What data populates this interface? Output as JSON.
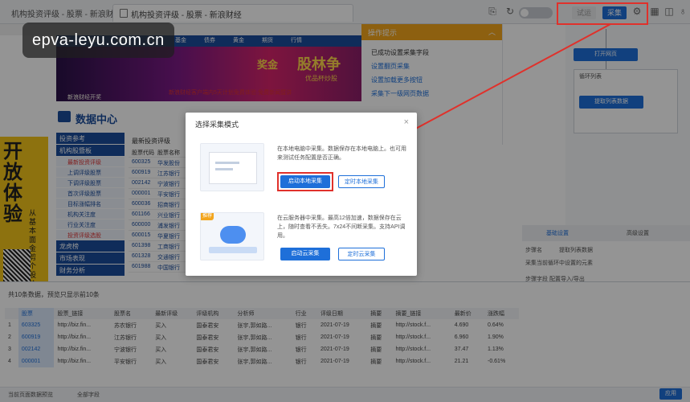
{
  "app": {
    "window_title": "机构投资评级 - 股票 - 新浪财经",
    "tab_title": "机构投资评级 - 股票 - 新浪财经"
  },
  "toolbar": {
    "trial_label": "试运",
    "collect_label": "采集"
  },
  "website": {
    "nav": [
      "首页",
      "新闻",
      "财经",
      "外汇",
      "基金",
      "债券",
      "黄金",
      "期货",
      "行情"
    ],
    "banner_texts": [
      "奖金",
      "股林争",
      "优品杯炒股",
      "新浪财经开奖"
    ],
    "notice": "新浪财经客户端内5天计划免费体验·免费新闻暨讲",
    "data_center_title": "数据中心",
    "left_ad_text": "开放体验",
    "left_ad_sub": "从基本面金剪个股价值",
    "side_menu": [
      {
        "group": "投资参考",
        "items": []
      },
      {
        "group": "机构股暨板",
        "items": [
          "最新投资评级",
          "上调评级股票",
          "下调评级股票",
          "首次评级股票",
          "目标涨幅排名",
          "机构关注度",
          "行业关注度",
          "投资评级选股"
        ]
      },
      {
        "group": "龙虎榜",
        "items": []
      },
      {
        "group": "市场表现",
        "items": []
      },
      {
        "group": "财务分析",
        "items": []
      }
    ],
    "table_title": "最新投资评级",
    "table_headers": [
      "股票代码",
      "股票名称"
    ],
    "table_rows": [
      [
        "600325",
        "华发股份"
      ],
      [
        "600919",
        "江苏银行"
      ],
      [
        "002142",
        "宁波银行"
      ],
      [
        "000001",
        "平安银行"
      ],
      [
        "600036",
        "招商银行"
      ],
      [
        "601166",
        "兴业银行"
      ],
      [
        "600000",
        "浦发银行"
      ],
      [
        "600015",
        "华夏银行"
      ],
      [
        "601398",
        "工商银行"
      ],
      [
        "601328",
        "交通银行"
      ],
      [
        "601988",
        "中国银行"
      ]
    ]
  },
  "right_panel": {
    "tips_title": "操作提示",
    "tips_items": [
      "已成功设置采集字段",
      "设置翻页采集",
      "设置加载更多按钮",
      "采集下一级网页数据"
    ],
    "flow_nodes": [
      "打开网页",
      "循环列表",
      "提取列表数据"
    ],
    "settings_tabs": [
      "基础设置",
      "高级设置"
    ],
    "settings_rows": [
      "步骤名",
      "提取列表数据",
      "采集当前循环中设置的元素",
      "步骤字段 配置导入/导出"
    ]
  },
  "bottom_table": {
    "summary": "共10条数据，预览只显示前10条",
    "headers": [
      "",
      "股票",
      "股票_链接",
      "股票名",
      "最新评级",
      "评级机构",
      "分析师",
      "行业",
      "评级日期",
      "摘要",
      "摘要_链接",
      "最新价",
      "涨跌幅"
    ],
    "rows": [
      [
        "1",
        "603325",
        "http://biz.fin...",
        "苏农银行",
        "买入",
        "国泰君安",
        "张宇,郭如路...",
        "银行",
        "2021-07-19",
        "摘要",
        "http://stock.f...",
        "4.690",
        "0.64%"
      ],
      [
        "2",
        "600919",
        "http://biz.fin...",
        "江苏银行",
        "买入",
        "国泰君安",
        "张宇,郭如路...",
        "银行",
        "2021-07-19",
        "摘要",
        "http://stock.f...",
        "6.960",
        "1.90%"
      ],
      [
        "3",
        "002142",
        "http://biz.fin...",
        "宁波银行",
        "买入",
        "国泰君安",
        "张宇,郭如路...",
        "银行",
        "2021-07-19",
        "摘要",
        "http://stock.f...",
        "37.47",
        "1.13%"
      ],
      [
        "4",
        "000001",
        "http://biz.fin...",
        "平安银行",
        "买入",
        "国泰君安",
        "张宇,郭如路...",
        "银行",
        "2021-07-19",
        "摘要",
        "http://stock.f...",
        "21.21",
        "-0.61%"
      ]
    ],
    "footer_left": "当前页面数据预览",
    "footer_mid": "全部字段",
    "apply_label": "应用"
  },
  "dialog": {
    "title": "选择采集模式",
    "close": "×",
    "local": {
      "desc": "在本地电脑中采集。数据保存在本地电脑上。也可用来测试任务配置是否正确。",
      "start_label": "启动本地采集",
      "schedule_label": "定时本地采集"
    },
    "cloud": {
      "badge": "推荐",
      "desc": "在云服务器中采集。最高12倍加速，数据保存在云上，随时查看不丢失。7x24不间断采集。支持API调用。",
      "start_label": "启动云采集",
      "schedule_label": "定时云采集"
    }
  },
  "watermark": "epva-leyu.com.cn",
  "colors": {
    "accent": "#1e6fd9",
    "highlight_border": "#e0312b",
    "tips_header": "#f3a51d",
    "site_nav": "#1a4c9c"
  }
}
